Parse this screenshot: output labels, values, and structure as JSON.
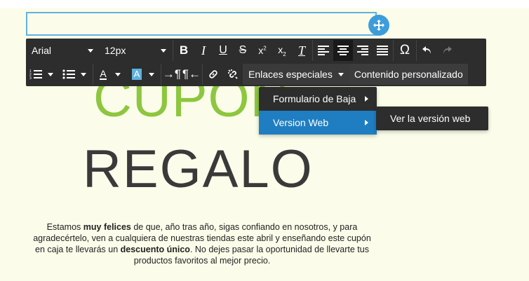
{
  "toolbar": {
    "font_family": "Arial",
    "font_size": "12px",
    "special_links_label": "Enlaces especiales",
    "custom_content_label": "Contenido personalizado"
  },
  "special_links_menu": {
    "items": [
      {
        "label": "Formulario de Baja"
      },
      {
        "label": "Version Web"
      }
    ]
  },
  "version_web_submenu": {
    "items": [
      {
        "label": "Ver la versión web"
      }
    ]
  },
  "content": {
    "headline_1": "CUPÓN",
    "headline_2": "REGALO",
    "paragraph": {
      "p1": "Estamos ",
      "b1": "muy felices",
      "p2": " de que, año tras año, sigas confiando en nosotros, y para agradecértelo, ven a cualquiera de nuestras tiendas este abril y enseñando este cupón en caja te llevarás un ",
      "b2": "descuento único",
      "p3": ". No dejes pasar la oportunidad de llevarte tus productos favoritos al mejor precio."
    }
  },
  "colors": {
    "background": "#fbfdea",
    "toolbar": "#2d2d2d",
    "accent": "#3d9ddb",
    "highlight": "#1f7ec1",
    "headline_green": "#8dc63f",
    "headline_dark": "#3a3a3a"
  },
  "icons": [
    "move-icon",
    "bold-icon",
    "italic-icon",
    "underline-icon",
    "strikethrough-icon",
    "superscript-icon",
    "subscript-icon",
    "clear-format-icon",
    "align-left-icon",
    "align-center-icon",
    "align-right-icon",
    "align-justify-icon",
    "omega-icon",
    "undo-icon",
    "redo-icon",
    "ordered-list-icon",
    "unordered-list-icon",
    "text-color-icon",
    "background-color-icon",
    "ltr-icon",
    "rtl-icon",
    "link-icon",
    "unlink-icon"
  ]
}
